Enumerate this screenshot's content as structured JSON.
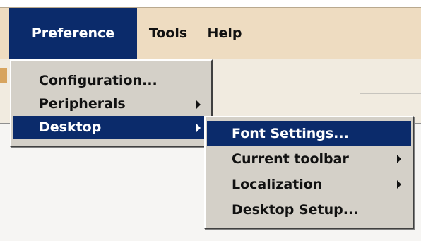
{
  "menubar": {
    "items": [
      {
        "label": "Preference"
      },
      {
        "label": "Tools"
      },
      {
        "label": "Help"
      }
    ]
  },
  "preference_menu": {
    "items": [
      {
        "label": "Configuration..."
      },
      {
        "label": "Peripherals",
        "has_submenu": true
      },
      {
        "label": "Desktop",
        "has_submenu": true,
        "highlighted": true
      }
    ]
  },
  "desktop_submenu": {
    "items": [
      {
        "label": "Font Settings...",
        "highlighted": true
      },
      {
        "label": "Current toolbar",
        "has_submenu": true
      },
      {
        "label": "Localization",
        "has_submenu": true
      },
      {
        "label": "Desktop Setup..."
      }
    ]
  },
  "colors": {
    "menubar_bg": "#eedcc1",
    "highlight": "#0b2b6b",
    "menu_bg": "#d4d0c8"
  },
  "icons": {
    "submenu_arrow": "chevron-right-icon"
  }
}
